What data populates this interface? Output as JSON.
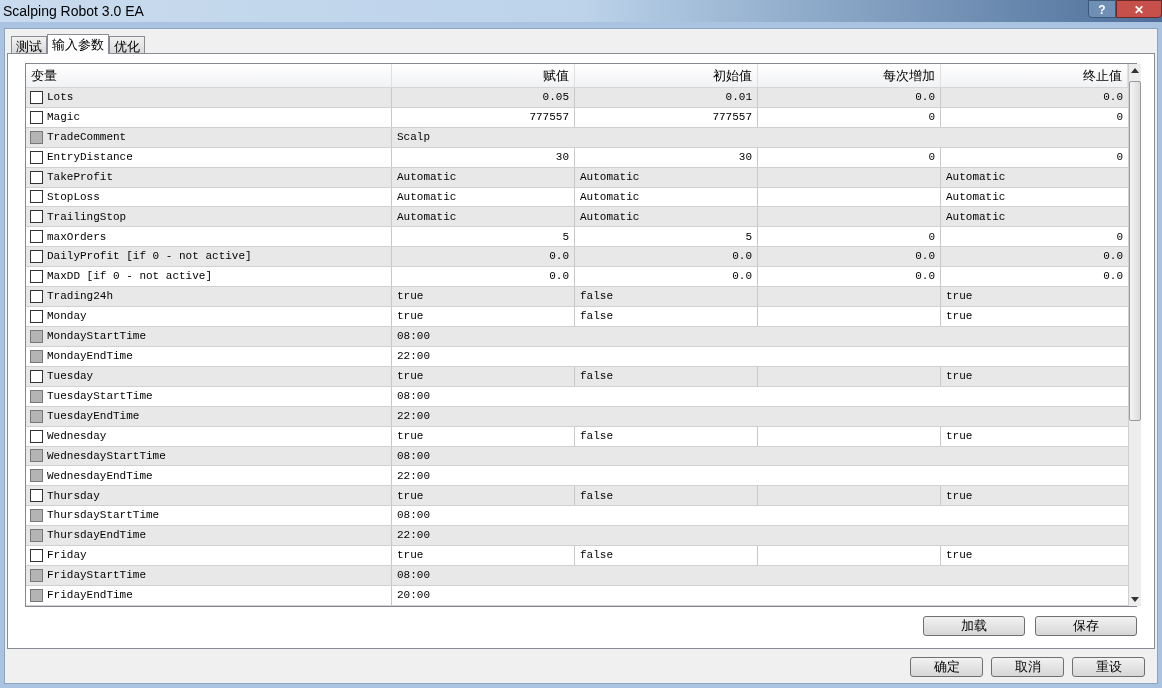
{
  "window": {
    "title": "Scalping Robot 3.0 EA",
    "help": "?",
    "close": "✕"
  },
  "tabs": [
    {
      "label": "测试",
      "selected": false
    },
    {
      "label": "输入参数",
      "selected": true
    },
    {
      "label": "优化",
      "selected": false
    }
  ],
  "table": {
    "columns": [
      "变量",
      "赋值",
      "初始值",
      "每次增加",
      "终止值"
    ],
    "rows": [
      {
        "kind": "number",
        "name": "Lots",
        "checked": false,
        "disabled": false,
        "value": "0.05",
        "start": "0.01",
        "step": "0.0",
        "stop": "0.0"
      },
      {
        "kind": "number",
        "name": "Magic",
        "checked": false,
        "disabled": false,
        "value": "777557",
        "start": "777557",
        "step": "0",
        "stop": "0"
      },
      {
        "kind": "text",
        "name": "TradeComment",
        "checked": false,
        "disabled": true,
        "value": "Scalp"
      },
      {
        "kind": "number",
        "name": "EntryDistance",
        "checked": false,
        "disabled": false,
        "value": "30",
        "start": "30",
        "step": "0",
        "stop": "0"
      },
      {
        "kind": "option",
        "name": "TakeProfit",
        "checked": false,
        "disabled": false,
        "value": "Automatic",
        "start": "Automatic",
        "stop": "Automatic"
      },
      {
        "kind": "option",
        "name": "StopLoss",
        "checked": false,
        "disabled": false,
        "value": "Automatic",
        "start": "Automatic",
        "stop": "Automatic"
      },
      {
        "kind": "option",
        "name": "TrailingStop",
        "checked": false,
        "disabled": false,
        "value": "Automatic",
        "start": "Automatic",
        "stop": "Automatic"
      },
      {
        "kind": "number",
        "name": "maxOrders",
        "checked": false,
        "disabled": false,
        "value": "5",
        "start": "5",
        "step": "0",
        "stop": "0"
      },
      {
        "kind": "number",
        "name": "DailyProfit [if 0 - not active]",
        "checked": false,
        "disabled": false,
        "value": "0.0",
        "start": "0.0",
        "step": "0.0",
        "stop": "0.0"
      },
      {
        "kind": "number",
        "name": "MaxDD [if 0 - not active]",
        "checked": false,
        "disabled": false,
        "value": "0.0",
        "start": "0.0",
        "step": "0.0",
        "stop": "0.0"
      },
      {
        "kind": "option",
        "name": "Trading24h",
        "checked": false,
        "disabled": false,
        "value": "true",
        "start": "false",
        "stop": "true"
      },
      {
        "kind": "option",
        "name": "Monday",
        "checked": false,
        "disabled": false,
        "value": "true",
        "start": "false",
        "stop": "true"
      },
      {
        "kind": "text",
        "name": "MondayStartTime",
        "checked": false,
        "disabled": true,
        "value": "08:00"
      },
      {
        "kind": "text",
        "name": "MondayEndTime",
        "checked": false,
        "disabled": true,
        "value": "22:00"
      },
      {
        "kind": "option",
        "name": "Tuesday",
        "checked": false,
        "disabled": false,
        "value": "true",
        "start": "false",
        "stop": "true"
      },
      {
        "kind": "text",
        "name": "TuesdayStartTime",
        "checked": false,
        "disabled": true,
        "value": "08:00"
      },
      {
        "kind": "text",
        "name": "TuesdayEndTime",
        "checked": false,
        "disabled": true,
        "value": "22:00"
      },
      {
        "kind": "option",
        "name": "Wednesday",
        "checked": false,
        "disabled": false,
        "value": "true",
        "start": "false",
        "stop": "true"
      },
      {
        "kind": "text",
        "name": "WednesdayStartTime",
        "checked": false,
        "disabled": true,
        "value": "08:00"
      },
      {
        "kind": "text",
        "name": "WednesdayEndTime",
        "checked": false,
        "disabled": true,
        "value": "22:00"
      },
      {
        "kind": "option",
        "name": "Thursday",
        "checked": false,
        "disabled": false,
        "value": "true",
        "start": "false",
        "stop": "true"
      },
      {
        "kind": "text",
        "name": "ThursdayStartTime",
        "checked": false,
        "disabled": true,
        "value": "08:00"
      },
      {
        "kind": "text",
        "name": "ThursdayEndTime",
        "checked": false,
        "disabled": true,
        "value": "22:00"
      },
      {
        "kind": "option",
        "name": "Friday",
        "checked": false,
        "disabled": false,
        "value": "true",
        "start": "false",
        "stop": "true"
      },
      {
        "kind": "text",
        "name": "FridayStartTime",
        "checked": false,
        "disabled": true,
        "value": "08:00"
      },
      {
        "kind": "text",
        "name": "FridayEndTime",
        "checked": false,
        "disabled": true,
        "value": "20:00"
      }
    ]
  },
  "panel_buttons": [
    "加载",
    "保存"
  ],
  "dialog_buttons": [
    "确定",
    "取消",
    "重设"
  ]
}
